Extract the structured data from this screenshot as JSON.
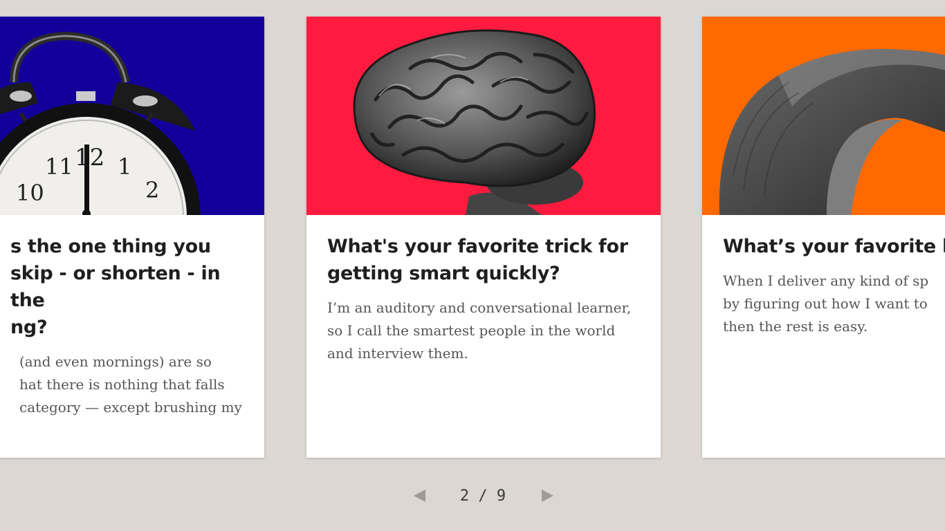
{
  "cards": [
    {
      "title": "What's the one thing you skip - or shorten - in the morning?",
      "title_visible": "s the one thing you\nskip - or shorten - in the\nng?",
      "body_visible": "(and even mornings) are so\nhat there is nothing that falls\ncategory — except brushing my",
      "image_icon": "alarm-clock-icon",
      "bg_color": "#13009b"
    },
    {
      "title": "What's your favorite trick for getting smart quickly?",
      "body": "I’m an auditory and conversational learner, so I call the smartest people in the world and interview them.",
      "image_icon": "brain-icon",
      "bg_color": "#ff1b40"
    },
    {
      "title_visible": "What’s your favorite lif",
      "body_visible": "When I deliver any kind of sp\nby figuring out how I want to\nthen the rest is easy.",
      "image_icon": "tape-roll-icon",
      "bg_color": "#ff6a00"
    }
  ],
  "pager": {
    "current": "2",
    "separator": "/",
    "total": "9",
    "display": "2 / 9",
    "prev_icon": "triangle-left-icon",
    "next_icon": "triangle-right-icon"
  },
  "colors": {
    "background": "#dcd7d2",
    "card_bg": "#ffffff",
    "title_color": "#1f1f1f",
    "body_color": "#555555",
    "arrow_color": "#a09a94"
  }
}
